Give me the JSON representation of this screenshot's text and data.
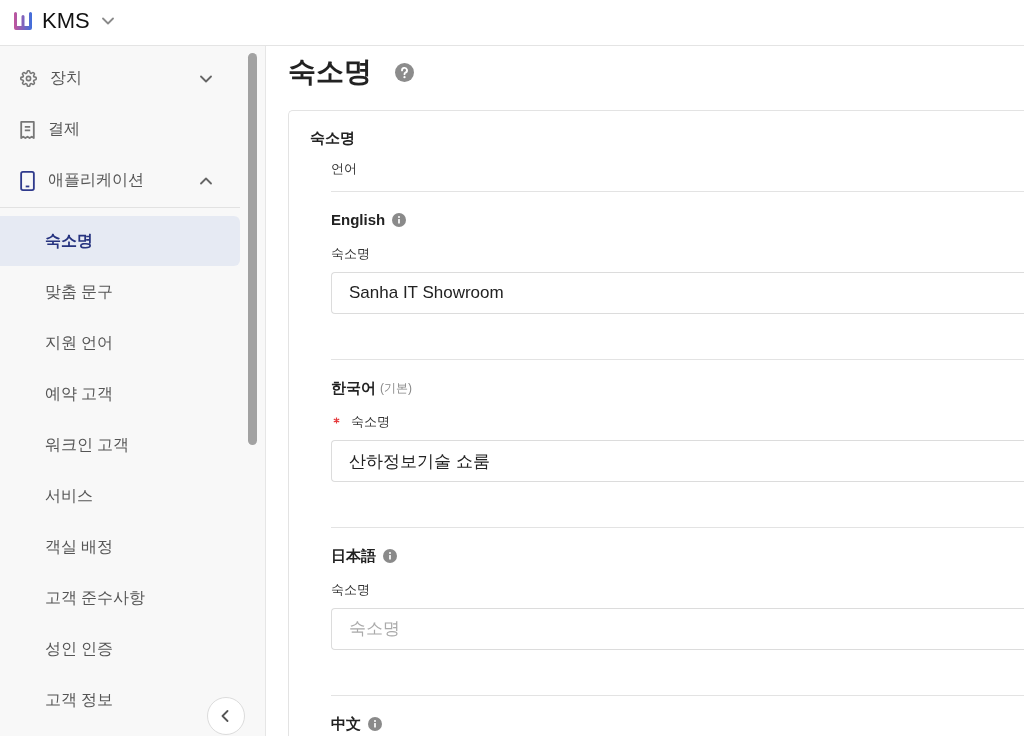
{
  "app": {
    "name": "KMS"
  },
  "sidebar": {
    "items": [
      {
        "label": "장치",
        "expanded": false
      },
      {
        "label": "결제"
      },
      {
        "label": "애플리케이션",
        "expanded": true,
        "children": [
          {
            "label": "숙소명",
            "selected": true
          },
          {
            "label": "맞춤 문구",
            "selected": false
          },
          {
            "label": "지원 언어",
            "selected": false
          },
          {
            "label": "예약 고객",
            "selected": false
          },
          {
            "label": "워크인 고객",
            "selected": false
          },
          {
            "label": "서비스",
            "selected": false
          },
          {
            "label": "객실 배정",
            "selected": false
          },
          {
            "label": "고객 준수사항",
            "selected": false
          },
          {
            "label": "성인 인증",
            "selected": false
          },
          {
            "label": "고객 정보",
            "selected": false
          }
        ]
      }
    ]
  },
  "page": {
    "title": "숙소명"
  },
  "card": {
    "title": "숙소명",
    "column_label": "언어",
    "languages": [
      {
        "name": "English",
        "info": true,
        "field": {
          "label": "숙소명",
          "required": false,
          "value": "Sanha IT Showroom"
        }
      },
      {
        "name": "한국어",
        "note": "(기본)",
        "info": false,
        "field": {
          "label": "숙소명",
          "required": true,
          "value": "산하정보기술 쇼룸"
        }
      },
      {
        "name": "日本語",
        "info": true,
        "field": {
          "label": "숙소명",
          "required": false,
          "placeholder": "숙소명"
        }
      },
      {
        "name": "中文",
        "info": true
      }
    ]
  }
}
